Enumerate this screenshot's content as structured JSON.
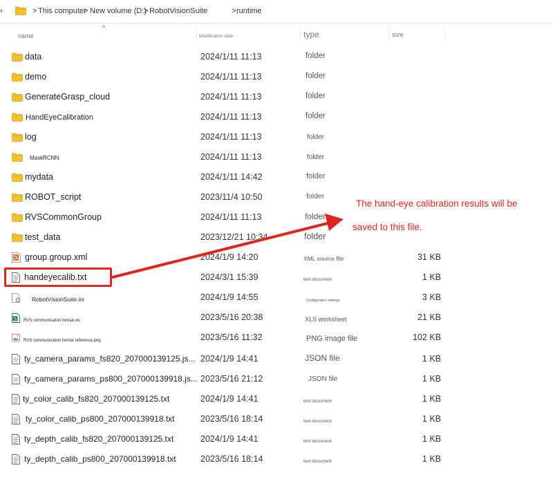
{
  "address": {
    "crumbs": [
      "This computer",
      "New volume (D:)",
      "RobotVisionSuite",
      "runtime"
    ],
    "separator": ">"
  },
  "columns": {
    "name": "name",
    "modified": "Modification date",
    "type": "type",
    "size": "size"
  },
  "files": [
    {
      "name": "data",
      "date": "2024/1/11 11:13",
      "type": "folder",
      "size": "",
      "icon": "folder-icon"
    },
    {
      "name": "demo",
      "date": "2024/1/11 11:13",
      "type": "folder",
      "size": "",
      "icon": "folder-icon"
    },
    {
      "name": "GenerateGrasp_cloud",
      "date": "2024/1/11 11:13",
      "type": "folder",
      "size": "",
      "icon": "folder-icon"
    },
    {
      "name": "HandEyeCalibration",
      "date": "2024/1/11 11:13",
      "type": "folder",
      "size": "",
      "icon": "folder-icon"
    },
    {
      "name": "log",
      "date": "2024/1/11 11:13",
      "type": "folder",
      "size": "",
      "icon": "folder-icon"
    },
    {
      "name": "MaskRCNN",
      "date": "2024/1/11 11:13",
      "type": "folder",
      "size": "",
      "icon": "folder-icon"
    },
    {
      "name": "mydata",
      "date": "2024/1/11 14:42",
      "type": "folder",
      "size": "",
      "icon": "folder-icon"
    },
    {
      "name": "ROBOT_script",
      "date": "2023/11/4 10:50",
      "type": "folder",
      "size": "",
      "icon": "folder-icon"
    },
    {
      "name": "RVSCommonGroup",
      "date": "2024/1/11 11:13",
      "type": "folder",
      "size": "",
      "icon": "folder-icon"
    },
    {
      "name": "test_data",
      "date": "2023/12/21 10:34",
      "type": "folder",
      "size": "",
      "icon": "folder-icon"
    },
    {
      "name": "group.group.xml",
      "date": "2024/1/9 14:20",
      "type": "XML source file",
      "size": "31 KB",
      "icon": "xml-file-icon"
    },
    {
      "name": "handeyecalib.txt",
      "date": "2024/3/1 15:39",
      "type": "text document",
      "size": "1 KB",
      "icon": "text-file-icon"
    },
    {
      "name": "RobotVisionSuite.ini",
      "date": "2024/1/9 14:55",
      "type": "Configuration settings",
      "size": "3 KB",
      "icon": "ini-file-icon"
    },
    {
      "name": "RVS communication format.xls",
      "date": "2023/5/16 20:38",
      "type": "XLS worksheet",
      "size": "21 KB",
      "icon": "xls-file-icon"
    },
    {
      "name": "RVS communication format reference.png",
      "date": "2023/5/16 11:32",
      "type": "PNG image file",
      "size": "102 KB",
      "icon": "png-file-icon"
    },
    {
      "name": "ty_camera_params_fs820_207000139125.js...",
      "date": "2024/1/9 14:41",
      "type": "JSON file",
      "size": "1 KB",
      "icon": "json-file-icon"
    },
    {
      "name": "ty_camera_params_ps800_207000139918.js...",
      "date": "2023/5/16 21:12",
      "type": "JSON file",
      "size": "1 KB",
      "icon": "json-file-icon"
    },
    {
      "name": "ty_color_calib_fs820_207000139125.txt",
      "date": "2024/1/9 14:41",
      "type": "text document",
      "size": "1 KB",
      "icon": "text-file-icon"
    },
    {
      "name": "ty_color_calib_ps800_207000139918.txt",
      "date": "2023/5/16 18:14",
      "type": "text document",
      "size": "1 KB",
      "icon": "text-file-icon"
    },
    {
      "name": "ty_depth_calib_fs820_207000139125.txt",
      "date": "2024/1/9 14:41",
      "type": "text document",
      "size": "1 KB",
      "icon": "text-file-icon"
    },
    {
      "name": "ty_depth_calib_ps800_207000139918.txt",
      "date": "2023/5/16 18:14",
      "type": "text document",
      "size": "1 KB",
      "icon": "text-file-icon"
    }
  ],
  "annotation": {
    "line1": "The hand-eye calibration results will be",
    "line2": "saved to this file.",
    "color": "#e0261c"
  }
}
